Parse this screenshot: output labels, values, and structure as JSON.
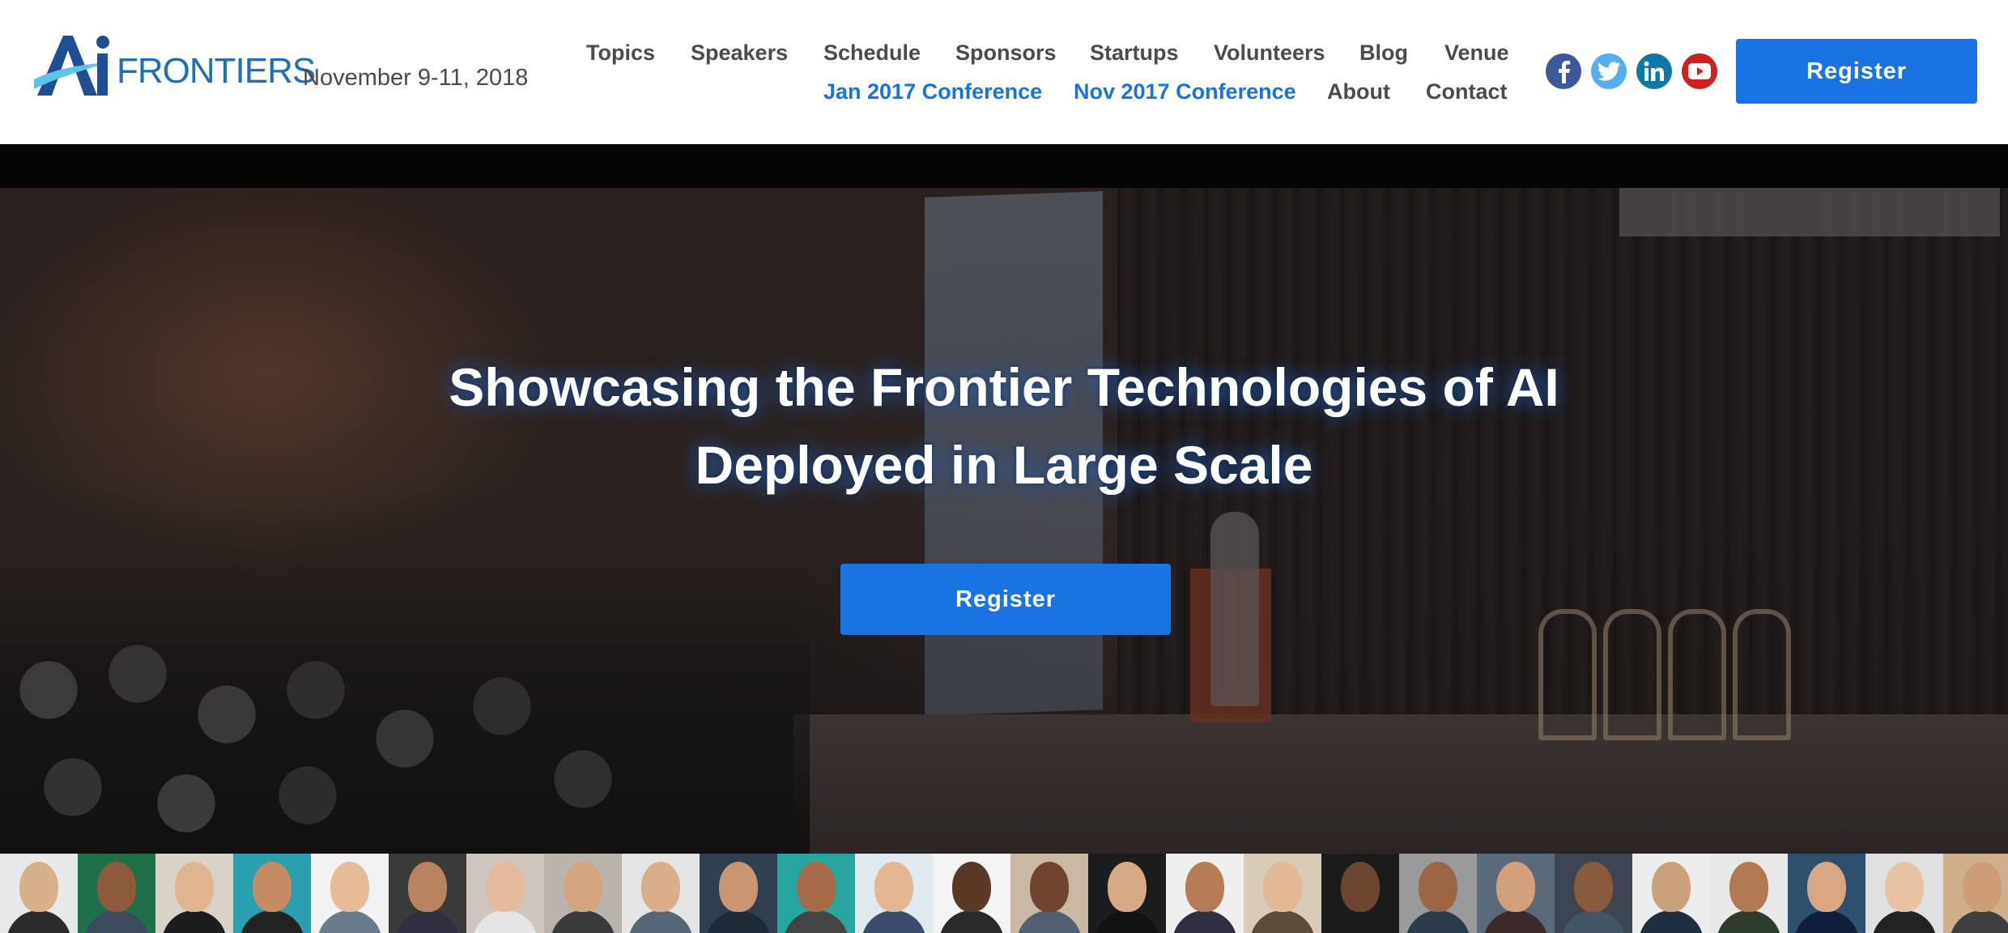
{
  "header": {
    "logo": {
      "ai": "Ai",
      "text": "FRONTIERS"
    },
    "date": "November 9-11, 2018",
    "nav_row1": [
      "Topics",
      "Speakers",
      "Schedule",
      "Sponsors",
      "Startups",
      "Volunteers",
      "Blog",
      "Venue"
    ],
    "nav_row2": [
      {
        "label": "Jan 2017 Conference",
        "highlight": true
      },
      {
        "label": "Nov 2017 Conference",
        "highlight": true
      },
      {
        "label": "About",
        "highlight": false
      },
      {
        "label": "Contact",
        "highlight": false
      }
    ],
    "social": [
      {
        "icon": "facebook-icon",
        "color": "#3b5998"
      },
      {
        "icon": "twitter-icon",
        "color": "#55acee"
      },
      {
        "icon": "linkedin-icon",
        "color": "#0e76a8"
      },
      {
        "icon": "youtube-icon",
        "color": "#cd201f"
      }
    ],
    "register_label": "Register"
  },
  "hero": {
    "title_line1": "Showcasing the Frontier Technologies of AI",
    "title_line2": "Deployed in Large Scale",
    "register_label": "Register"
  },
  "speakers": {
    "count": 26
  },
  "colors": {
    "accent": "#1a73e3",
    "link_blue": "#1a73d9",
    "nav_text": "#4b4b4b"
  }
}
